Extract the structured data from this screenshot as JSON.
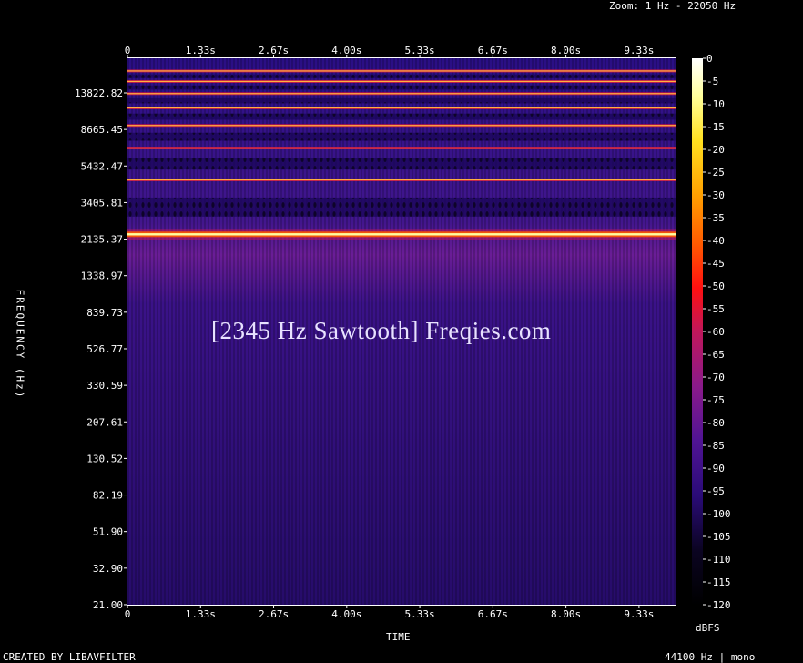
{
  "header": {
    "zoom": "Zoom: 1 Hz - 22050 Hz"
  },
  "footer": {
    "credit": "CREATED BY LIBAVFILTER",
    "format": "44100 Hz | mono"
  },
  "chart_data": {
    "type": "heatmap",
    "title": "[2345 Hz Sawtooth] Freqies.com",
    "xlabel": "TIME",
    "ylabel": "FREQUENCY (Hz)",
    "x_ticks": [
      "0",
      "1.33s",
      "2.67s",
      "4.00s",
      "5.33s",
      "6.67s",
      "8.00s",
      "9.33s"
    ],
    "y_ticks": [
      "13822.82",
      "8665.45",
      "5432.47",
      "3405.81",
      "2135.37",
      "1338.97",
      "839.73",
      "526.77",
      "330.59",
      "207.61",
      "130.52",
      "82.19",
      "51.90",
      "32.90",
      "21.00"
    ],
    "y_scale": "log",
    "colorbar": {
      "unit": "dBFS",
      "ticks": [
        "0",
        "-5",
        "-10",
        "-15",
        "-20",
        "-25",
        "-30",
        "-35",
        "-40",
        "-45",
        "-50",
        "-55",
        "-60",
        "-65",
        "-70",
        "-75",
        "-80",
        "-85",
        "-90",
        "-95",
        "-100",
        "-105",
        "-110",
        "-115",
        "-120"
      ],
      "range": [
        -120,
        0
      ],
      "colors": [
        "#000000",
        "#100030",
        "#3a0a8a",
        "#7a1590",
        "#c01a5a",
        "#ff1a10",
        "#ff7a00",
        "#ffd000",
        "#ffff90",
        "#ffffff"
      ]
    },
    "harmonics_hz": [
      2345,
      4690,
      7035,
      9380,
      11725,
      14070,
      16415,
      18760
    ],
    "fundamental_hz": 2345
  }
}
